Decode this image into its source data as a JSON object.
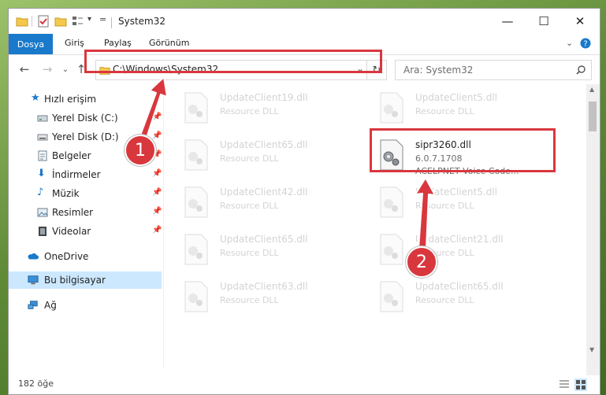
{
  "window": {
    "title": "System32",
    "controls": {
      "minimize": "—",
      "maximize": "☐",
      "close": "✕"
    }
  },
  "ribbon": {
    "tabs": [
      "Dosya",
      "Giriş",
      "Paylaş",
      "Görünüm"
    ],
    "collapse_icon": "chevron-down-icon",
    "help_icon": "help-icon"
  },
  "nav_bar": {
    "back_icon": "arrow-left-icon",
    "forward_icon": "arrow-right-icon",
    "recent_icon": "chevron-down-icon",
    "up_icon": "arrow-up-icon",
    "address": "C:\\Windows\\System32",
    "search_placeholder": "Ara: System32"
  },
  "sidebar": {
    "items": [
      {
        "label": "Hızlı erişim",
        "icon": "star-icon",
        "pinned": false
      },
      {
        "label": "Yerel Disk (C:)",
        "icon": "drive-icon",
        "pinned": true
      },
      {
        "label": "Yerel Disk (D:)",
        "icon": "drive-icon",
        "pinned": true
      },
      {
        "label": "Belgeler",
        "icon": "documents-icon",
        "pinned": true
      },
      {
        "label": "İndirmeler",
        "icon": "download-icon",
        "pinned": true
      },
      {
        "label": "Müzik",
        "icon": "music-icon",
        "pinned": true
      },
      {
        "label": "Resimler",
        "icon": "pictures-icon",
        "pinned": true
      },
      {
        "label": "Videolar",
        "icon": "videos-icon",
        "pinned": true
      },
      {
        "label": "OneDrive",
        "icon": "cloud-icon",
        "pinned": false
      },
      {
        "label": "Bu bilgisayar",
        "icon": "computer-icon",
        "pinned": false,
        "selected": true
      },
      {
        "label": "Ağ",
        "icon": "network-icon",
        "pinned": false
      }
    ]
  },
  "files": {
    "left": [
      {
        "name": "UpdateClient19.dll",
        "desc": "Resource DLL"
      },
      {
        "name": "UpdateClient65.dll",
        "desc": "Resource DLL"
      },
      {
        "name": "UpdateClient42.dll",
        "desc": "Resource DLL"
      },
      {
        "name": "UpdateClient65.dll",
        "desc": "Resource DLL"
      },
      {
        "name": "UpdateClient63.dll",
        "desc": "Resource DLL"
      }
    ],
    "right": [
      {
        "name": "UpdateClient5.dll",
        "desc": "Resource DLL"
      },
      {
        "name": "UpdateClient5.dll",
        "desc": "Resource DLL"
      },
      {
        "name": "UpdateClient21.dll",
        "desc": "Resource DLL"
      },
      {
        "name": "UpdateClient65.dll",
        "desc": "Resource DLL"
      }
    ],
    "target": {
      "name": "sipr3260.dll",
      "version": "6.0.7.1708",
      "desc": "ACELPNET Voice Code..."
    }
  },
  "annotations": {
    "step1": "1",
    "step2": "2",
    "color": "#d9373e"
  },
  "status": {
    "count": "182 öğe"
  },
  "colors": {
    "accent": "#1979ca",
    "selection": "#cce8ff",
    "highlight": "#d9373e"
  }
}
